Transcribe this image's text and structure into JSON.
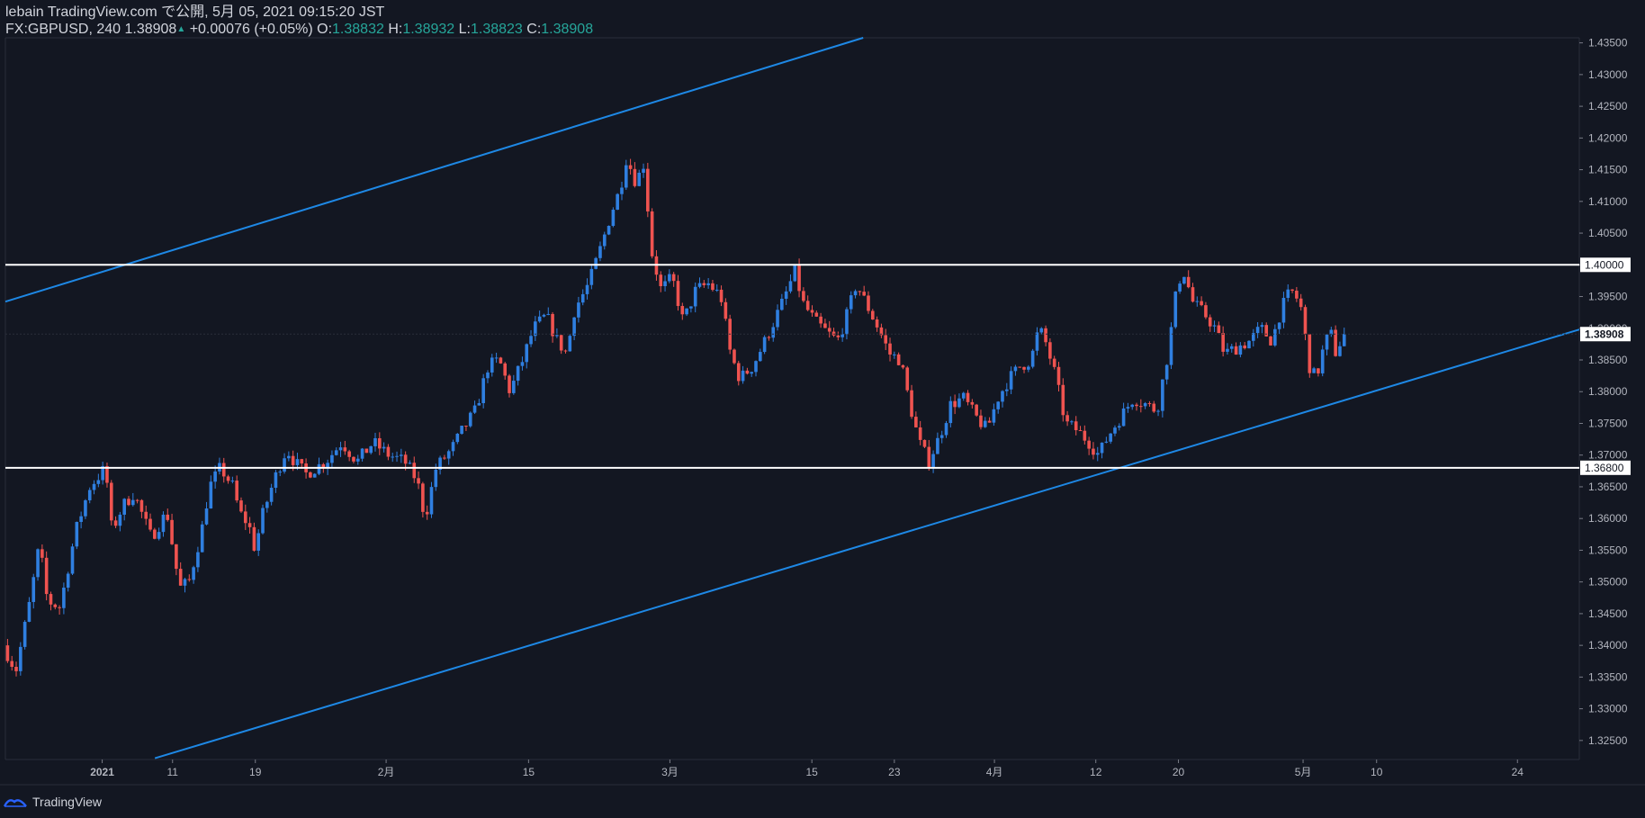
{
  "header": {
    "publish_line": "lebain TradingView.com で公開, 5月 05, 2021 09:15:20 JST",
    "symbol": "FX:GBPUSD, 240 1.38908",
    "change_arrow": "▲",
    "change": "+0.00076 (+0.05%)",
    "open_label": "O:",
    "open": "1.38832",
    "high_label": "H:",
    "high": "1.38932",
    "low_label": "L:",
    "low": "1.38823",
    "close_label": "C:",
    "close": "1.38908"
  },
  "footer": {
    "brand": "TradingView"
  },
  "colors": {
    "background": "#131722",
    "bull": "#2f7fe0",
    "bear": "#ef5350",
    "channel": "#1e88e5",
    "level": "#ffffff",
    "axis_text": "#b2b5be",
    "price_label_bg": "#ffffff",
    "last_price_bg": "#ffffff"
  },
  "chart_data": {
    "type": "candlestick",
    "symbol": "FX:GBPUSD",
    "timeframe": "240",
    "ylim": [
      1.322,
      1.4358
    ],
    "y_ticks": [
      "1.43500",
      "1.43000",
      "1.42500",
      "1.42000",
      "1.41500",
      "1.41000",
      "1.40500",
      "1.40000",
      "1.39500",
      "1.39000",
      "1.38500",
      "1.38000",
      "1.37500",
      "1.37000",
      "1.36500",
      "1.36000",
      "1.35500",
      "1.35000",
      "1.34500",
      "1.34000",
      "1.33500",
      "1.33000",
      "1.32500"
    ],
    "x_ticks": [
      {
        "label": "2021",
        "pos": 0.0615
      },
      {
        "label": "11",
        "pos": 0.1062
      },
      {
        "label": "19",
        "pos": 0.1588
      },
      {
        "label": "2月",
        "pos": 0.2419
      },
      {
        "label": "15",
        "pos": 0.3324
      },
      {
        "label": "3月",
        "pos": 0.4222
      },
      {
        "label": "15",
        "pos": 0.5124
      },
      {
        "label": "23",
        "pos": 0.5648
      },
      {
        "label": "4月",
        "pos": 0.6284
      },
      {
        "label": "12",
        "pos": 0.6928
      },
      {
        "label": "20",
        "pos": 0.7453
      },
      {
        "label": "5月",
        "pos": 0.8245
      },
      {
        "label": "10",
        "pos": 0.8712
      },
      {
        "label": "24",
        "pos": 0.9607
      }
    ],
    "path_anchors": [
      [
        0.0,
        1.34
      ],
      [
        0.008,
        1.336
      ],
      [
        0.017,
        1.347
      ],
      [
        0.023,
        1.356
      ],
      [
        0.028,
        1.347
      ],
      [
        0.036,
        1.346
      ],
      [
        0.046,
        1.358
      ],
      [
        0.055,
        1.365
      ],
      [
        0.065,
        1.368
      ],
      [
        0.069,
        1.358
      ],
      [
        0.076,
        1.362
      ],
      [
        0.083,
        1.364
      ],
      [
        0.094,
        1.357
      ],
      [
        0.104,
        1.361
      ],
      [
        0.112,
        1.349
      ],
      [
        0.118,
        1.35
      ],
      [
        0.126,
        1.358
      ],
      [
        0.131,
        1.365
      ],
      [
        0.138,
        1.368
      ],
      [
        0.146,
        1.365
      ],
      [
        0.15,
        1.361
      ],
      [
        0.156,
        1.359
      ],
      [
        0.16,
        1.355
      ],
      [
        0.164,
        1.36
      ],
      [
        0.172,
        1.366
      ],
      [
        0.18,
        1.371
      ],
      [
        0.185,
        1.369
      ],
      [
        0.192,
        1.367
      ],
      [
        0.205,
        1.369
      ],
      [
        0.215,
        1.372
      ],
      [
        0.225,
        1.369
      ],
      [
        0.235,
        1.372
      ],
      [
        0.245,
        1.37
      ],
      [
        0.255,
        1.369
      ],
      [
        0.263,
        1.366
      ],
      [
        0.268,
        1.36
      ],
      [
        0.275,
        1.368
      ],
      [
        0.285,
        1.371
      ],
      [
        0.292,
        1.374
      ],
      [
        0.3,
        1.377
      ],
      [
        0.308,
        1.384
      ],
      [
        0.315,
        1.385
      ],
      [
        0.322,
        1.38
      ],
      [
        0.33,
        1.385
      ],
      [
        0.337,
        1.39
      ],
      [
        0.345,
        1.392
      ],
      [
        0.352,
        1.388
      ],
      [
        0.358,
        1.386
      ],
      [
        0.363,
        1.393
      ],
      [
        0.372,
        1.397
      ],
      [
        0.38,
        1.403
      ],
      [
        0.386,
        1.408
      ],
      [
        0.392,
        1.412
      ],
      [
        0.396,
        1.417
      ],
      [
        0.402,
        1.413
      ],
      [
        0.407,
        1.416
      ],
      [
        0.412,
        1.402
      ],
      [
        0.418,
        1.396
      ],
      [
        0.425,
        1.398
      ],
      [
        0.432,
        1.391
      ],
      [
        0.44,
        1.396
      ],
      [
        0.448,
        1.397
      ],
      [
        0.456,
        1.395
      ],
      [
        0.462,
        1.386
      ],
      [
        0.468,
        1.382
      ],
      [
        0.476,
        1.384
      ],
      [
        0.484,
        1.388
      ],
      [
        0.495,
        1.394
      ],
      [
        0.503,
        1.399
      ],
      [
        0.508,
        1.394
      ],
      [
        0.516,
        1.391
      ],
      [
        0.525,
        1.389
      ],
      [
        0.53,
        1.388
      ],
      [
        0.536,
        1.392
      ],
      [
        0.542,
        1.397
      ],
      [
        0.548,
        1.394
      ],
      [
        0.556,
        1.39
      ],
      [
        0.563,
        1.386
      ],
      [
        0.57,
        1.385
      ],
      [
        0.576,
        1.378
      ],
      [
        0.582,
        1.372
      ],
      [
        0.588,
        1.369
      ],
      [
        0.595,
        1.373
      ],
      [
        0.602,
        1.378
      ],
      [
        0.61,
        1.379
      ],
      [
        0.618,
        1.376
      ],
      [
        0.625,
        1.374
      ],
      [
        0.632,
        1.379
      ],
      [
        0.639,
        1.382
      ],
      [
        0.646,
        1.384
      ],
      [
        0.653,
        1.385
      ],
      [
        0.658,
        1.39
      ],
      [
        0.662,
        1.388
      ],
      [
        0.668,
        1.383
      ],
      [
        0.675,
        1.375
      ],
      [
        0.682,
        1.374
      ],
      [
        0.69,
        1.372
      ],
      [
        0.696,
        1.37
      ],
      [
        0.702,
        1.373
      ],
      [
        0.71,
        1.376
      ],
      [
        0.718,
        1.379
      ],
      [
        0.726,
        1.378
      ],
      [
        0.733,
        1.377
      ],
      [
        0.74,
        1.386
      ],
      [
        0.746,
        1.397
      ],
      [
        0.75,
        1.399
      ],
      [
        0.756,
        1.394
      ],
      [
        0.764,
        1.392
      ],
      [
        0.77,
        1.39
      ],
      [
        0.776,
        1.386
      ],
      [
        0.784,
        1.387
      ],
      [
        0.792,
        1.388
      ],
      [
        0.799,
        1.39
      ],
      [
        0.806,
        1.388
      ],
      [
        0.812,
        1.393
      ],
      [
        0.818,
        1.396
      ],
      [
        0.824,
        1.394
      ],
      [
        0.83,
        1.384
      ],
      [
        0.834,
        1.382
      ],
      [
        0.84,
        1.388
      ],
      [
        0.844,
        1.389
      ],
      [
        0.846,
        1.386
      ],
      [
        0.85,
        1.388
      ],
      [
        0.852,
        1.3891
      ]
    ],
    "channel_upper": {
      "from": [
        0.0,
        1.3942
      ],
      "to": [
        0.545,
        1.4358
      ]
    },
    "channel_lower": {
      "from": [
        0.095,
        1.3222
      ],
      "to": [
        1.0,
        1.3898
      ]
    },
    "levels": [
      {
        "price": 1.4,
        "label": "1.40000"
      },
      {
        "price": 1.368,
        "label": "1.36800"
      }
    ],
    "last_price": {
      "price": 1.38908,
      "label": "1.38908"
    }
  }
}
